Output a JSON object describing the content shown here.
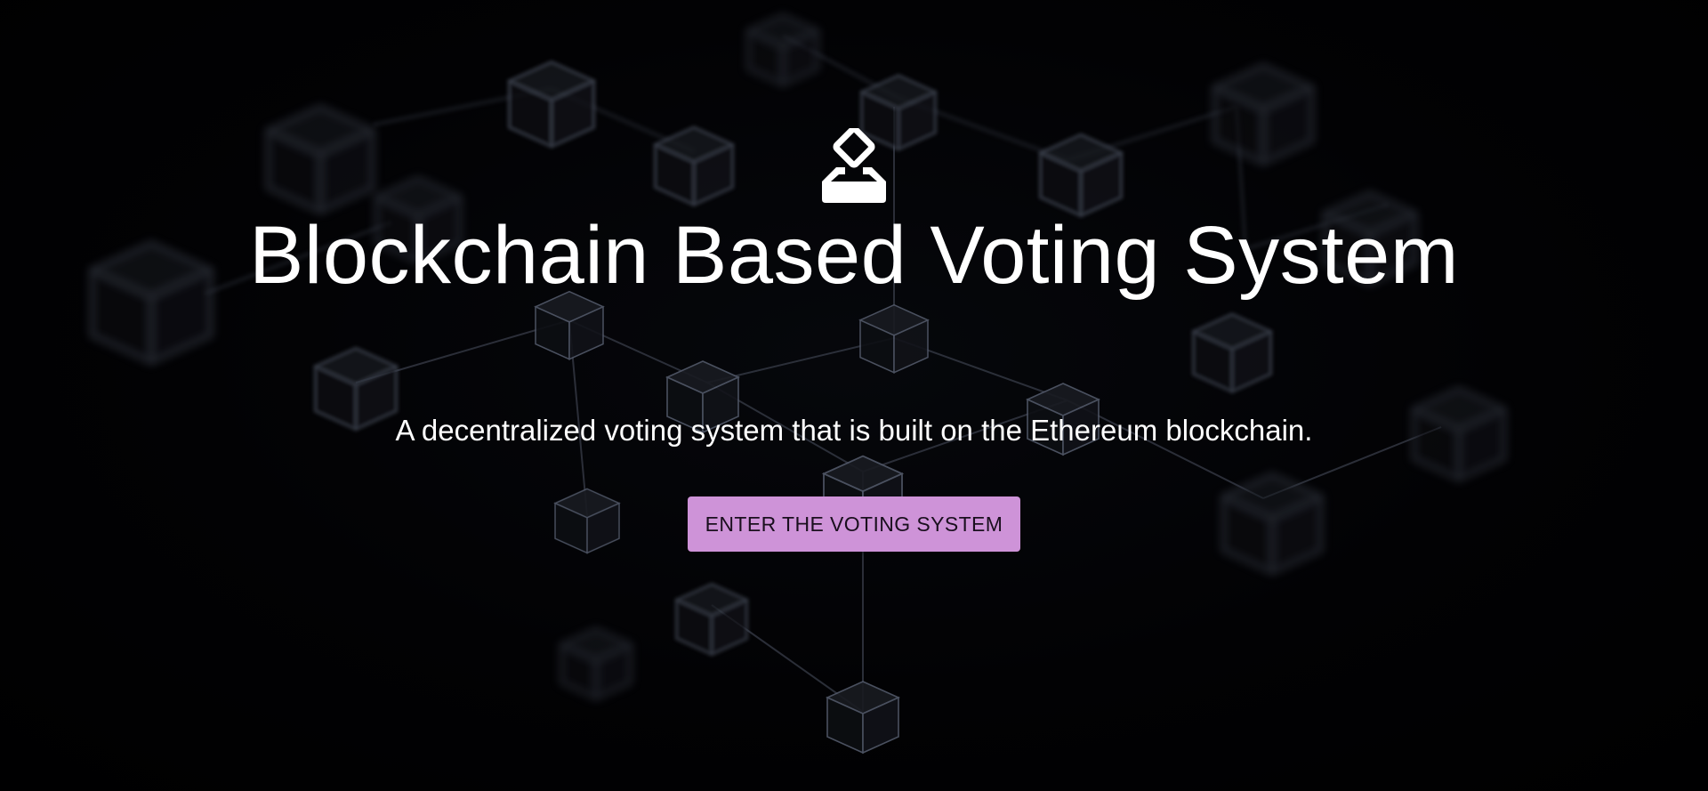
{
  "hero": {
    "logo_icon": "ballot-box-icon",
    "title": "Blockchain Based Voting System",
    "subtitle": "A decentralized voting system that is built on the Ethereum blockchain.",
    "cta_label": "ENTER THE VOTING SYSTEM"
  },
  "colors": {
    "background": "#020203",
    "cta_background": "#ce93d8",
    "cta_text": "#1a0f1e",
    "text": "#ffffff"
  }
}
